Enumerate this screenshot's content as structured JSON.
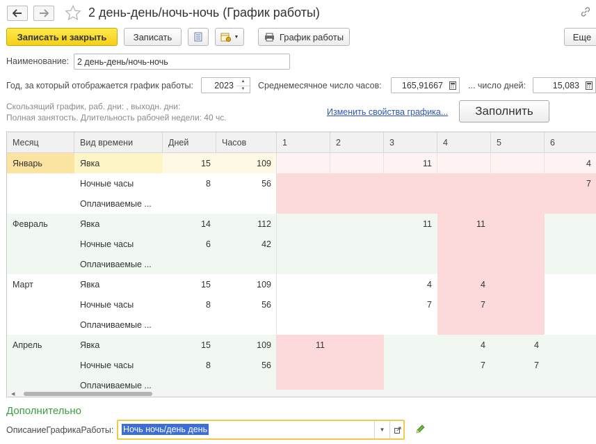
{
  "window": {
    "title": "2 день-день/ночь-ночь (График работы)"
  },
  "toolbar": {
    "save_close": "Записать и закрыть",
    "save": "Записать",
    "schedule": "График работы",
    "more": "Еще"
  },
  "form": {
    "name_label": "Наименование:",
    "name_value": "2 день-день/ночь-ночь",
    "year_label": "Год, за который отображается график работы:",
    "year_value": "2023",
    "avg_hours_label": "Среднемесячное число часов:",
    "avg_hours_value": "165,91667",
    "days_label": "... число дней:",
    "days_value": "15,083",
    "info_line1": "Скользящий график, раб. дни: , выходн. дни:",
    "info_line2": "Полная занятость. Длительность рабочей недели: 40 чс.",
    "change_link": "Изменить свойства графика...",
    "fill_button": "Заполнить"
  },
  "grid": {
    "headers": [
      "Месяц",
      "Вид времени",
      "Дней",
      "Часов",
      "1",
      "2",
      "3",
      "4",
      "5",
      "6"
    ],
    "rows": [
      {
        "month": "Январь",
        "type": "Явка",
        "days": "15",
        "hours": "109",
        "d": [
          "",
          "",
          "11",
          "",
          "",
          "4"
        ]
      },
      {
        "month": "",
        "type": "Ночные часы",
        "days": "8",
        "hours": "56",
        "d": [
          "",
          "",
          "",
          "",
          "",
          "7"
        ]
      },
      {
        "month": "",
        "type": "Оплачиваемые ...",
        "days": "",
        "hours": "",
        "d": [
          "",
          "",
          "",
          "",
          "",
          ""
        ]
      },
      {
        "month": "Февраль",
        "type": "Явка",
        "days": "14",
        "hours": "112",
        "d": [
          "",
          "",
          "11",
          "11",
          "",
          ""
        ]
      },
      {
        "month": "",
        "type": "Ночные часы",
        "days": "6",
        "hours": "42",
        "d": [
          "",
          "",
          "",
          "",
          "",
          ""
        ]
      },
      {
        "month": "",
        "type": "Оплачиваемые ...",
        "days": "",
        "hours": "",
        "d": [
          "",
          "",
          "",
          "",
          "",
          ""
        ]
      },
      {
        "month": "Март",
        "type": "Явка",
        "days": "15",
        "hours": "109",
        "d": [
          "",
          "",
          "4",
          "4",
          "",
          ""
        ]
      },
      {
        "month": "",
        "type": "Ночные часы",
        "days": "8",
        "hours": "56",
        "d": [
          "",
          "",
          "7",
          "7",
          "",
          ""
        ]
      },
      {
        "month": "",
        "type": "Оплачиваемые ...",
        "days": "",
        "hours": "",
        "d": [
          "",
          "",
          "",
          "",
          "",
          ""
        ]
      },
      {
        "month": "Апрель",
        "type": "Явка",
        "days": "15",
        "hours": "109",
        "d": [
          "11",
          "",
          "",
          "4",
          "4",
          ""
        ]
      },
      {
        "month": "",
        "type": "Ночные часы",
        "days": "8",
        "hours": "56",
        "d": [
          "",
          "",
          "",
          "7",
          "7",
          ""
        ]
      },
      {
        "month": "",
        "type": "Оплачиваемые ...",
        "days": "",
        "hours": "",
        "d": [
          "",
          "",
          "",
          "",
          "",
          ""
        ]
      }
    ]
  },
  "bottom": {
    "section_title": "Дополнительно",
    "desc_label": "ОписаниеГрафикаРаботы:",
    "desc_value": "Ночь ночь/день день"
  },
  "colors": {
    "primary_button": "#f5cf16",
    "weekend_pink": "#fddada",
    "selected_row": "#fdf5c6",
    "month_band": "#f1f8f1",
    "section_green": "#3aa13a",
    "link_blue": "#2b55b5"
  },
  "icons": [
    "back-arrow-icon",
    "forward-arrow-icon",
    "star-icon",
    "link-icon",
    "list-icon",
    "calendar-settings-icon",
    "printer-icon",
    "calculator-icon",
    "dropdown-arrow-icon",
    "open-icon",
    "pencil-icon"
  ]
}
